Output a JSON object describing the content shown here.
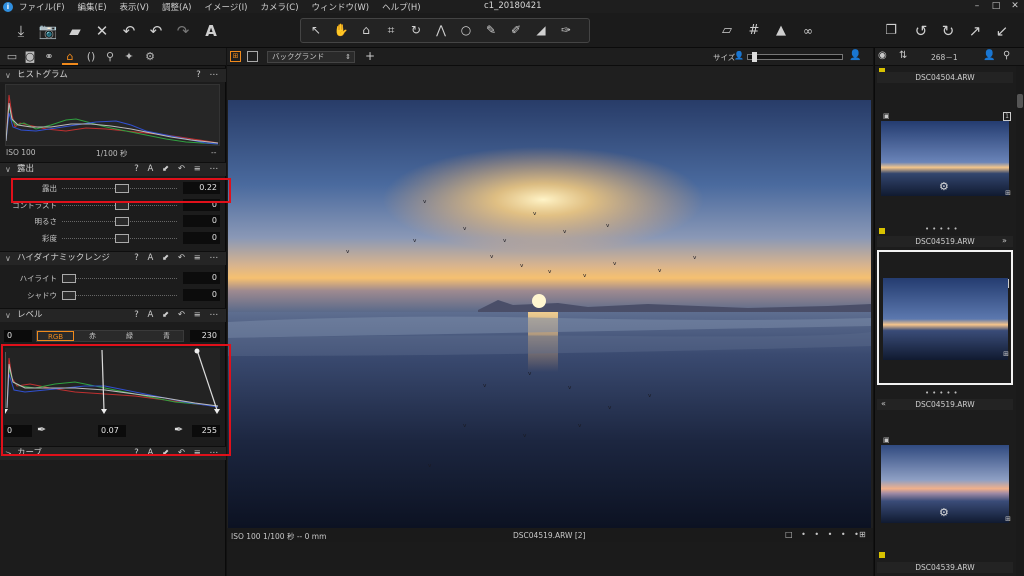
{
  "menu": {
    "items": [
      "ファイル(F)",
      "編集(E)",
      "表示(V)",
      "調整(A)",
      "イメージ(I)",
      "カメラ(C)",
      "ウィンドウ(W)",
      "ヘルプ(H)"
    ],
    "doc_title": "c1_20180421"
  },
  "toolbar": {
    "left_icons": [
      "import-icon",
      "camera-icon",
      "export-folder-icon",
      "delete-icon",
      "reset-icon",
      "undo-icon",
      "redo-icon",
      "text-icon"
    ],
    "cursor_tools": [
      "select-icon",
      "pan-icon",
      "loupe-icon",
      "crop-icon",
      "rotate-icon",
      "keystone-icon",
      "spot-icon",
      "brush-icon",
      "eraser-icon",
      "gradient-icon",
      "picker-icon"
    ],
    "right_icons": [
      "exposure-warning-icon",
      "grid-icon",
      "alert-icon",
      "proof-icon",
      "stack-icon",
      "rotate-left-icon",
      "rotate-right-icon",
      "expand-icon",
      "collapse-icon"
    ]
  },
  "left_panel": {
    "tab_icons": [
      "library-icon",
      "capture-icon",
      "color-icon",
      "exposure-tab-icon",
      "lens-icon",
      "details-icon",
      "adjust-icon",
      "settings-icon"
    ],
    "histogram": {
      "title": "ヒストグラム",
      "iso": "ISO 100",
      "shutter": "1/100 秒",
      "extra": "--"
    },
    "exposure": {
      "title": "露出",
      "tools": "? A ⬋ ↶ ≡ ⋯",
      "rows": [
        {
          "label": "露出",
          "value": "0.22",
          "knob": 0.46
        },
        {
          "label": "コントラスト",
          "value": "0",
          "knob": 0.46
        },
        {
          "label": "明るさ",
          "value": "0",
          "knob": 0.46
        },
        {
          "label": "彩度",
          "value": "0",
          "knob": 0.46
        }
      ]
    },
    "hdr": {
      "title": "ハイダイナミックレンジ",
      "tools": "? A ⬋ ↶ ≡ ⋯",
      "rows": [
        {
          "label": "ハイライト",
          "value": "0",
          "knob": 0.0
        },
        {
          "label": "シャドウ",
          "value": "0",
          "knob": 0.0
        }
      ]
    },
    "levels": {
      "title": "レベル",
      "tools": "? A ⬋ ↶ ≡ ⋯",
      "min_out": "0",
      "max_out": "230",
      "channels": [
        "RGB",
        "赤",
        "緑",
        "青"
      ],
      "min_in": "0",
      "mid": "0.07",
      "max_in": "255"
    },
    "curve": {
      "title": "カーブ",
      "tools": "? A ⬋ ↶ ≡ ⋯"
    }
  },
  "center": {
    "bg_select": "バックグランド",
    "size_label": "サイズ",
    "status_left": "ISO 100 1/100 秒 -- 0 mm",
    "status_center": "DSC04519.ARW [2]"
  },
  "right_panel": {
    "count": "268－1",
    "thumbs": [
      {
        "name": "DSC04504.ARW"
      },
      {
        "name": "DSC04519.ARW",
        "badge": "1"
      },
      {
        "name": "DSC04519.ARW",
        "badge": "2"
      },
      {
        "name": "DSC04539.ARW"
      }
    ]
  },
  "colors": {
    "accent": "#f08a1c",
    "highlight_box": "#e0101a",
    "rating_yellow": "#d8c200"
  }
}
